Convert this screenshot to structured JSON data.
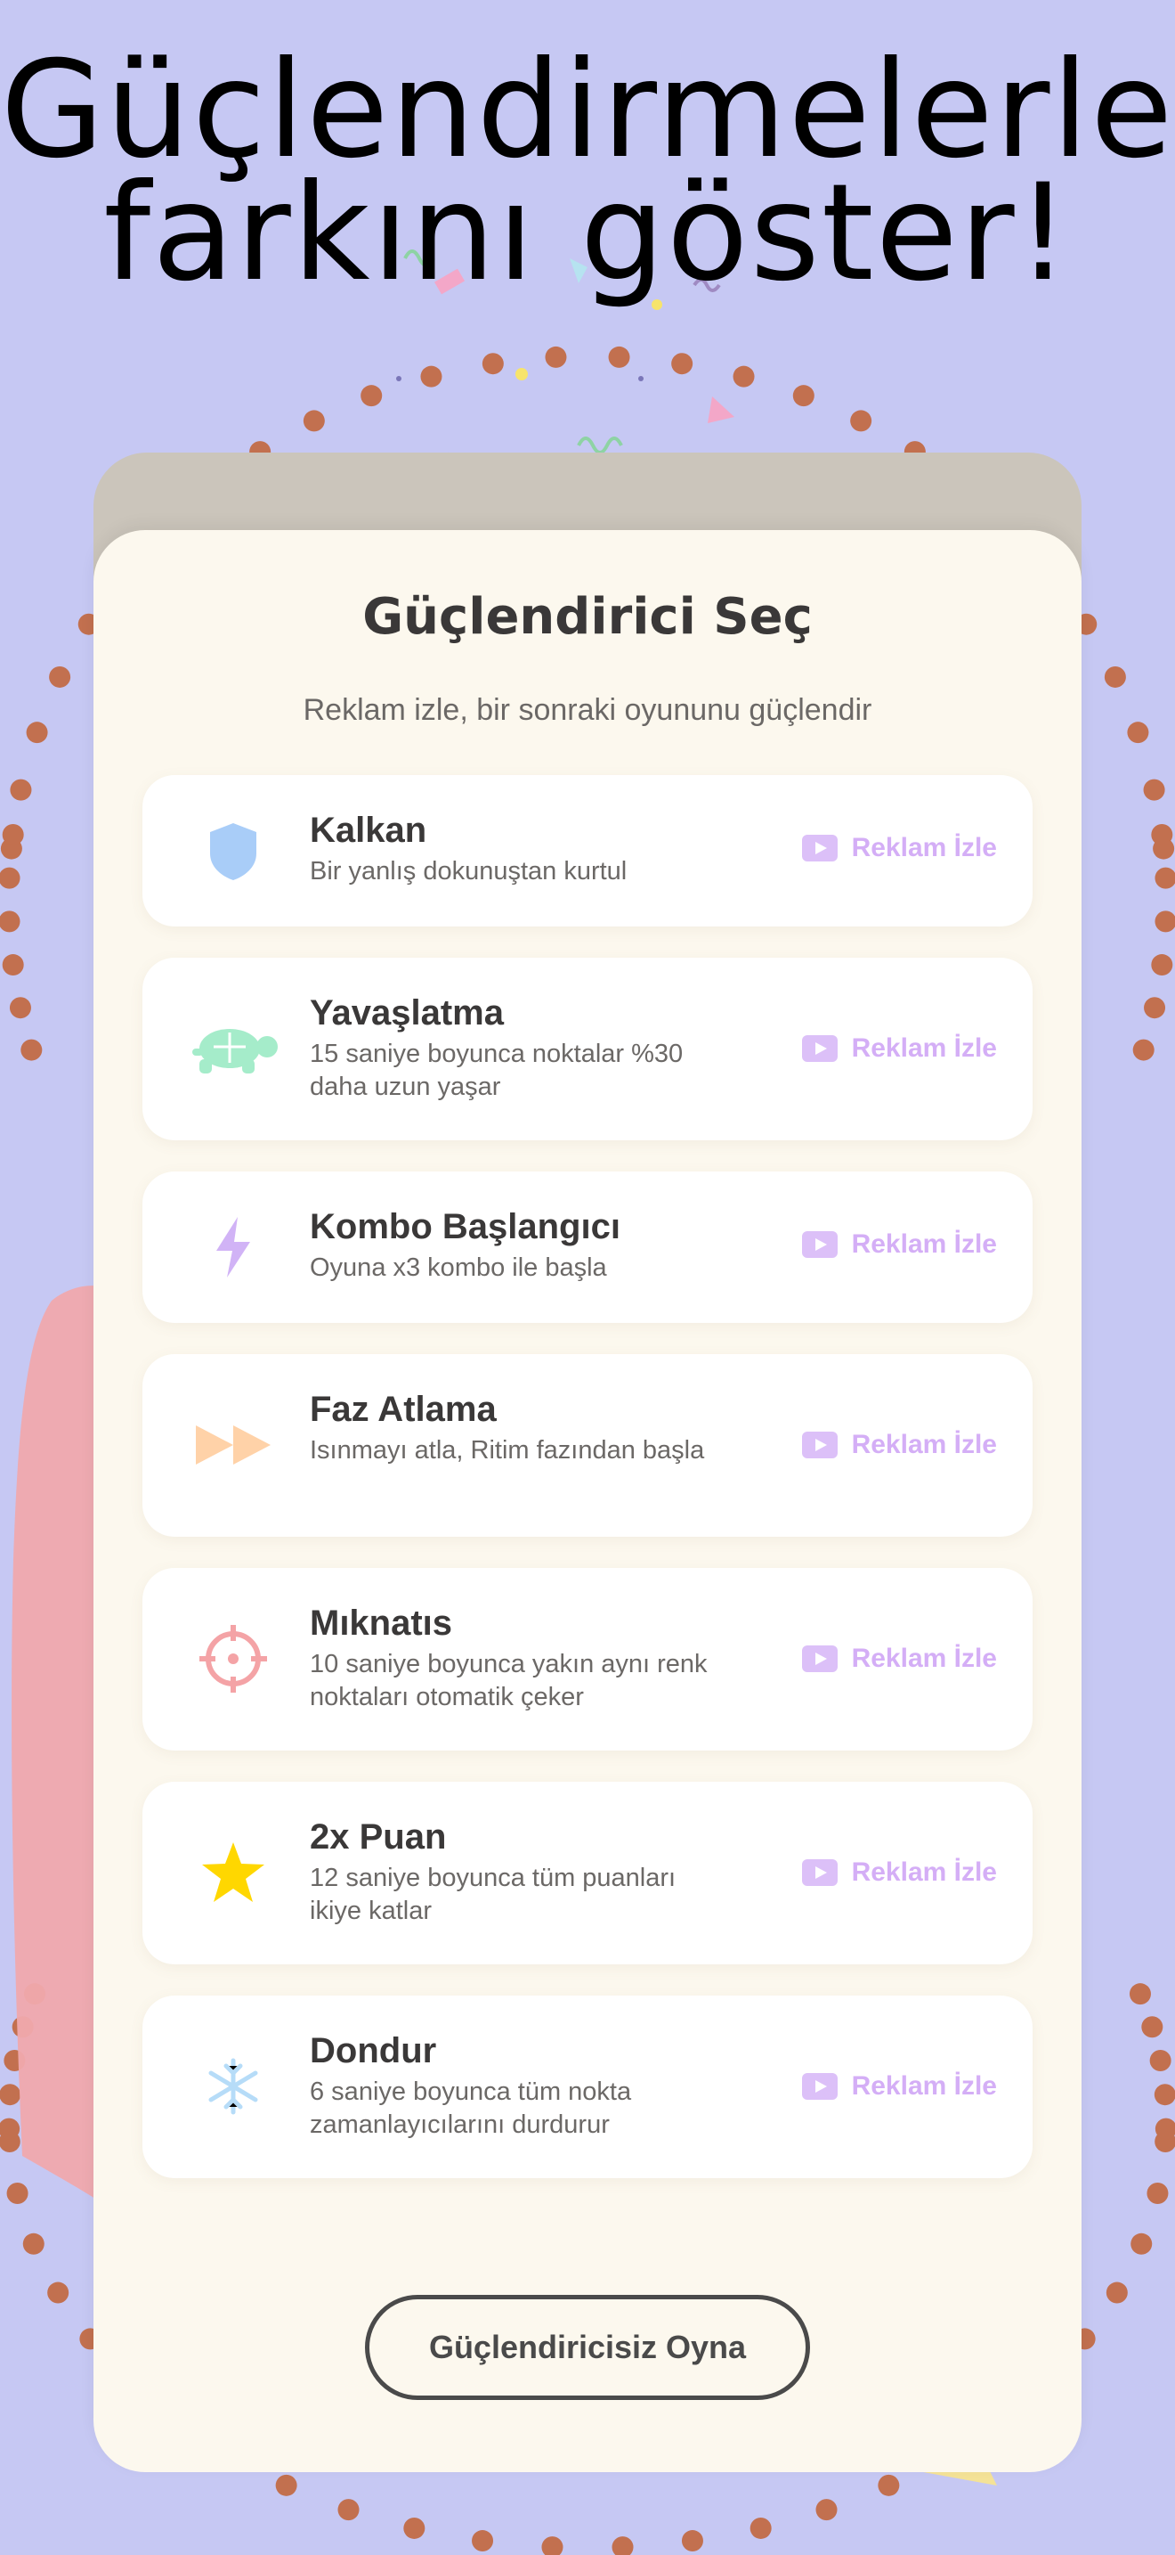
{
  "headline": {
    "line1": "Güçlendirmelerle",
    "line2": "farkını göster!"
  },
  "panel": {
    "title": "Güçlendirici Seç",
    "subtitle": "Reklam izle, bir sonraki oyununu güçlendir",
    "ad_label": "Reklam İzle",
    "ad_icon": "play-icon",
    "powerups": [
      {
        "name": "Kalkan",
        "desc": "Bir yanlış dokunuştan kurtul",
        "icon": "shield-icon",
        "color": "#a9cdf8"
      },
      {
        "name": "Yavaşlatma",
        "desc": "15 saniye boyunca noktalar %30 daha uzun yaşar",
        "icon": "turtle-icon",
        "color": "#a5ecca"
      },
      {
        "name": "Kombo Başlangıcı",
        "desc": "Oyuna x3 kombo ile başla",
        "icon": "lightning-icon",
        "color": "#d1b3f6"
      },
      {
        "name": "Faz Atlama",
        "desc": "Isınmayı atla, Ritim fazından başla",
        "icon": "fast-forward-icon",
        "color": "#ffd2a8"
      },
      {
        "name": "Mıknatıs",
        "desc": "10 saniye boyunca yakın aynı renk noktaları otomatik çeker",
        "icon": "crosshair-icon",
        "color": "#f4a3a6"
      },
      {
        "name": "2x Puan",
        "desc": "12 saniye boyunca tüm puanları ikiye katlar",
        "icon": "star-icon",
        "color": "#ffd700"
      },
      {
        "name": "Dondur",
        "desc": "6 saniye boyunca tüm nokta zamanlayıcılarını durdurur",
        "icon": "snowflake-icon",
        "color": "#b6dcf8"
      }
    ],
    "play_button": "Güçlendiricisiz Oyna"
  },
  "colors": {
    "background": "#c6c8f3",
    "card": "#fcf8ee",
    "card_back": "#cbc5bb",
    "dots": "#c2704f",
    "ad_accent": "#d4aef6"
  }
}
